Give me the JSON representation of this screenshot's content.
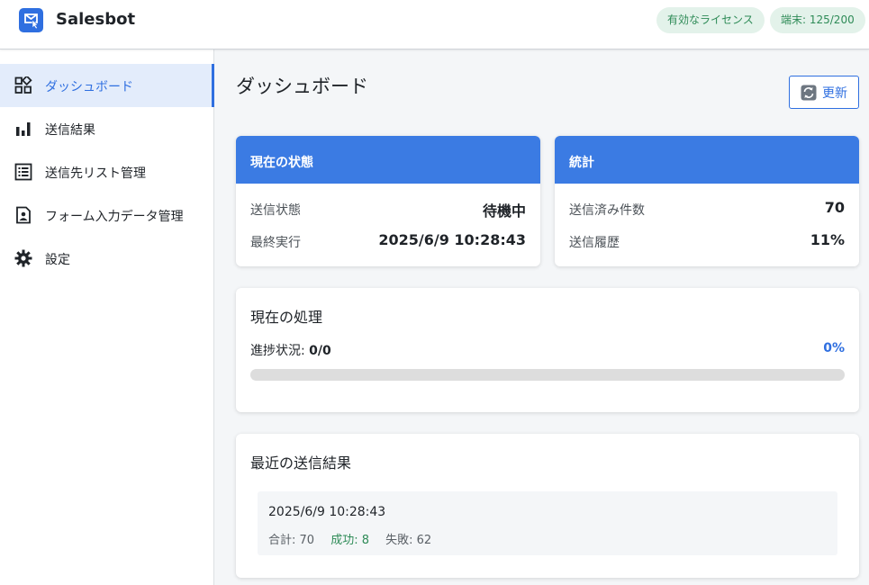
{
  "header": {
    "app_title": "Salesbot",
    "license_badge": "有効なライセンス",
    "device_badge": "端末: 125/200"
  },
  "sidebar": {
    "items": [
      {
        "label": "ダッシュボード",
        "icon": "dashboard-icon",
        "active": true
      },
      {
        "label": "送信結果",
        "icon": "bar-chart-icon"
      },
      {
        "label": "送信先リスト管理",
        "icon": "list-icon"
      },
      {
        "label": "フォーム入力データ管理",
        "icon": "contact-card-icon"
      },
      {
        "label": "設定",
        "icon": "gear-icon"
      }
    ]
  },
  "main": {
    "title": "ダッシュボード",
    "refresh_label": "更新",
    "status_card": {
      "title": "現在の状態",
      "rows": [
        {
          "key": "送信状態",
          "value": "待機中"
        },
        {
          "key": "最終実行",
          "value": "2025/6/9 10:28:43"
        }
      ]
    },
    "stats_card": {
      "title": "統計",
      "rows": [
        {
          "key": "送信済み件数",
          "value": "70"
        },
        {
          "key": "送信履歴",
          "value": "11%"
        }
      ]
    },
    "processing": {
      "title": "現在の処理",
      "progress_label": "進捗状況:",
      "progress_value": "0/0",
      "progress_percent": "0%",
      "progress_fraction": 0
    },
    "recent": {
      "title": "最近の送信結果",
      "entries": [
        {
          "date": "2025/6/9 10:28:43",
          "total": "合計: 70",
          "success": "成功: 8",
          "failure": "失敗: 62"
        }
      ]
    }
  },
  "colors": {
    "accent": "#2f6fe0",
    "card_header": "#3b7be3",
    "success": "#2e8b57",
    "badge_bg": "#e3f2ea"
  }
}
